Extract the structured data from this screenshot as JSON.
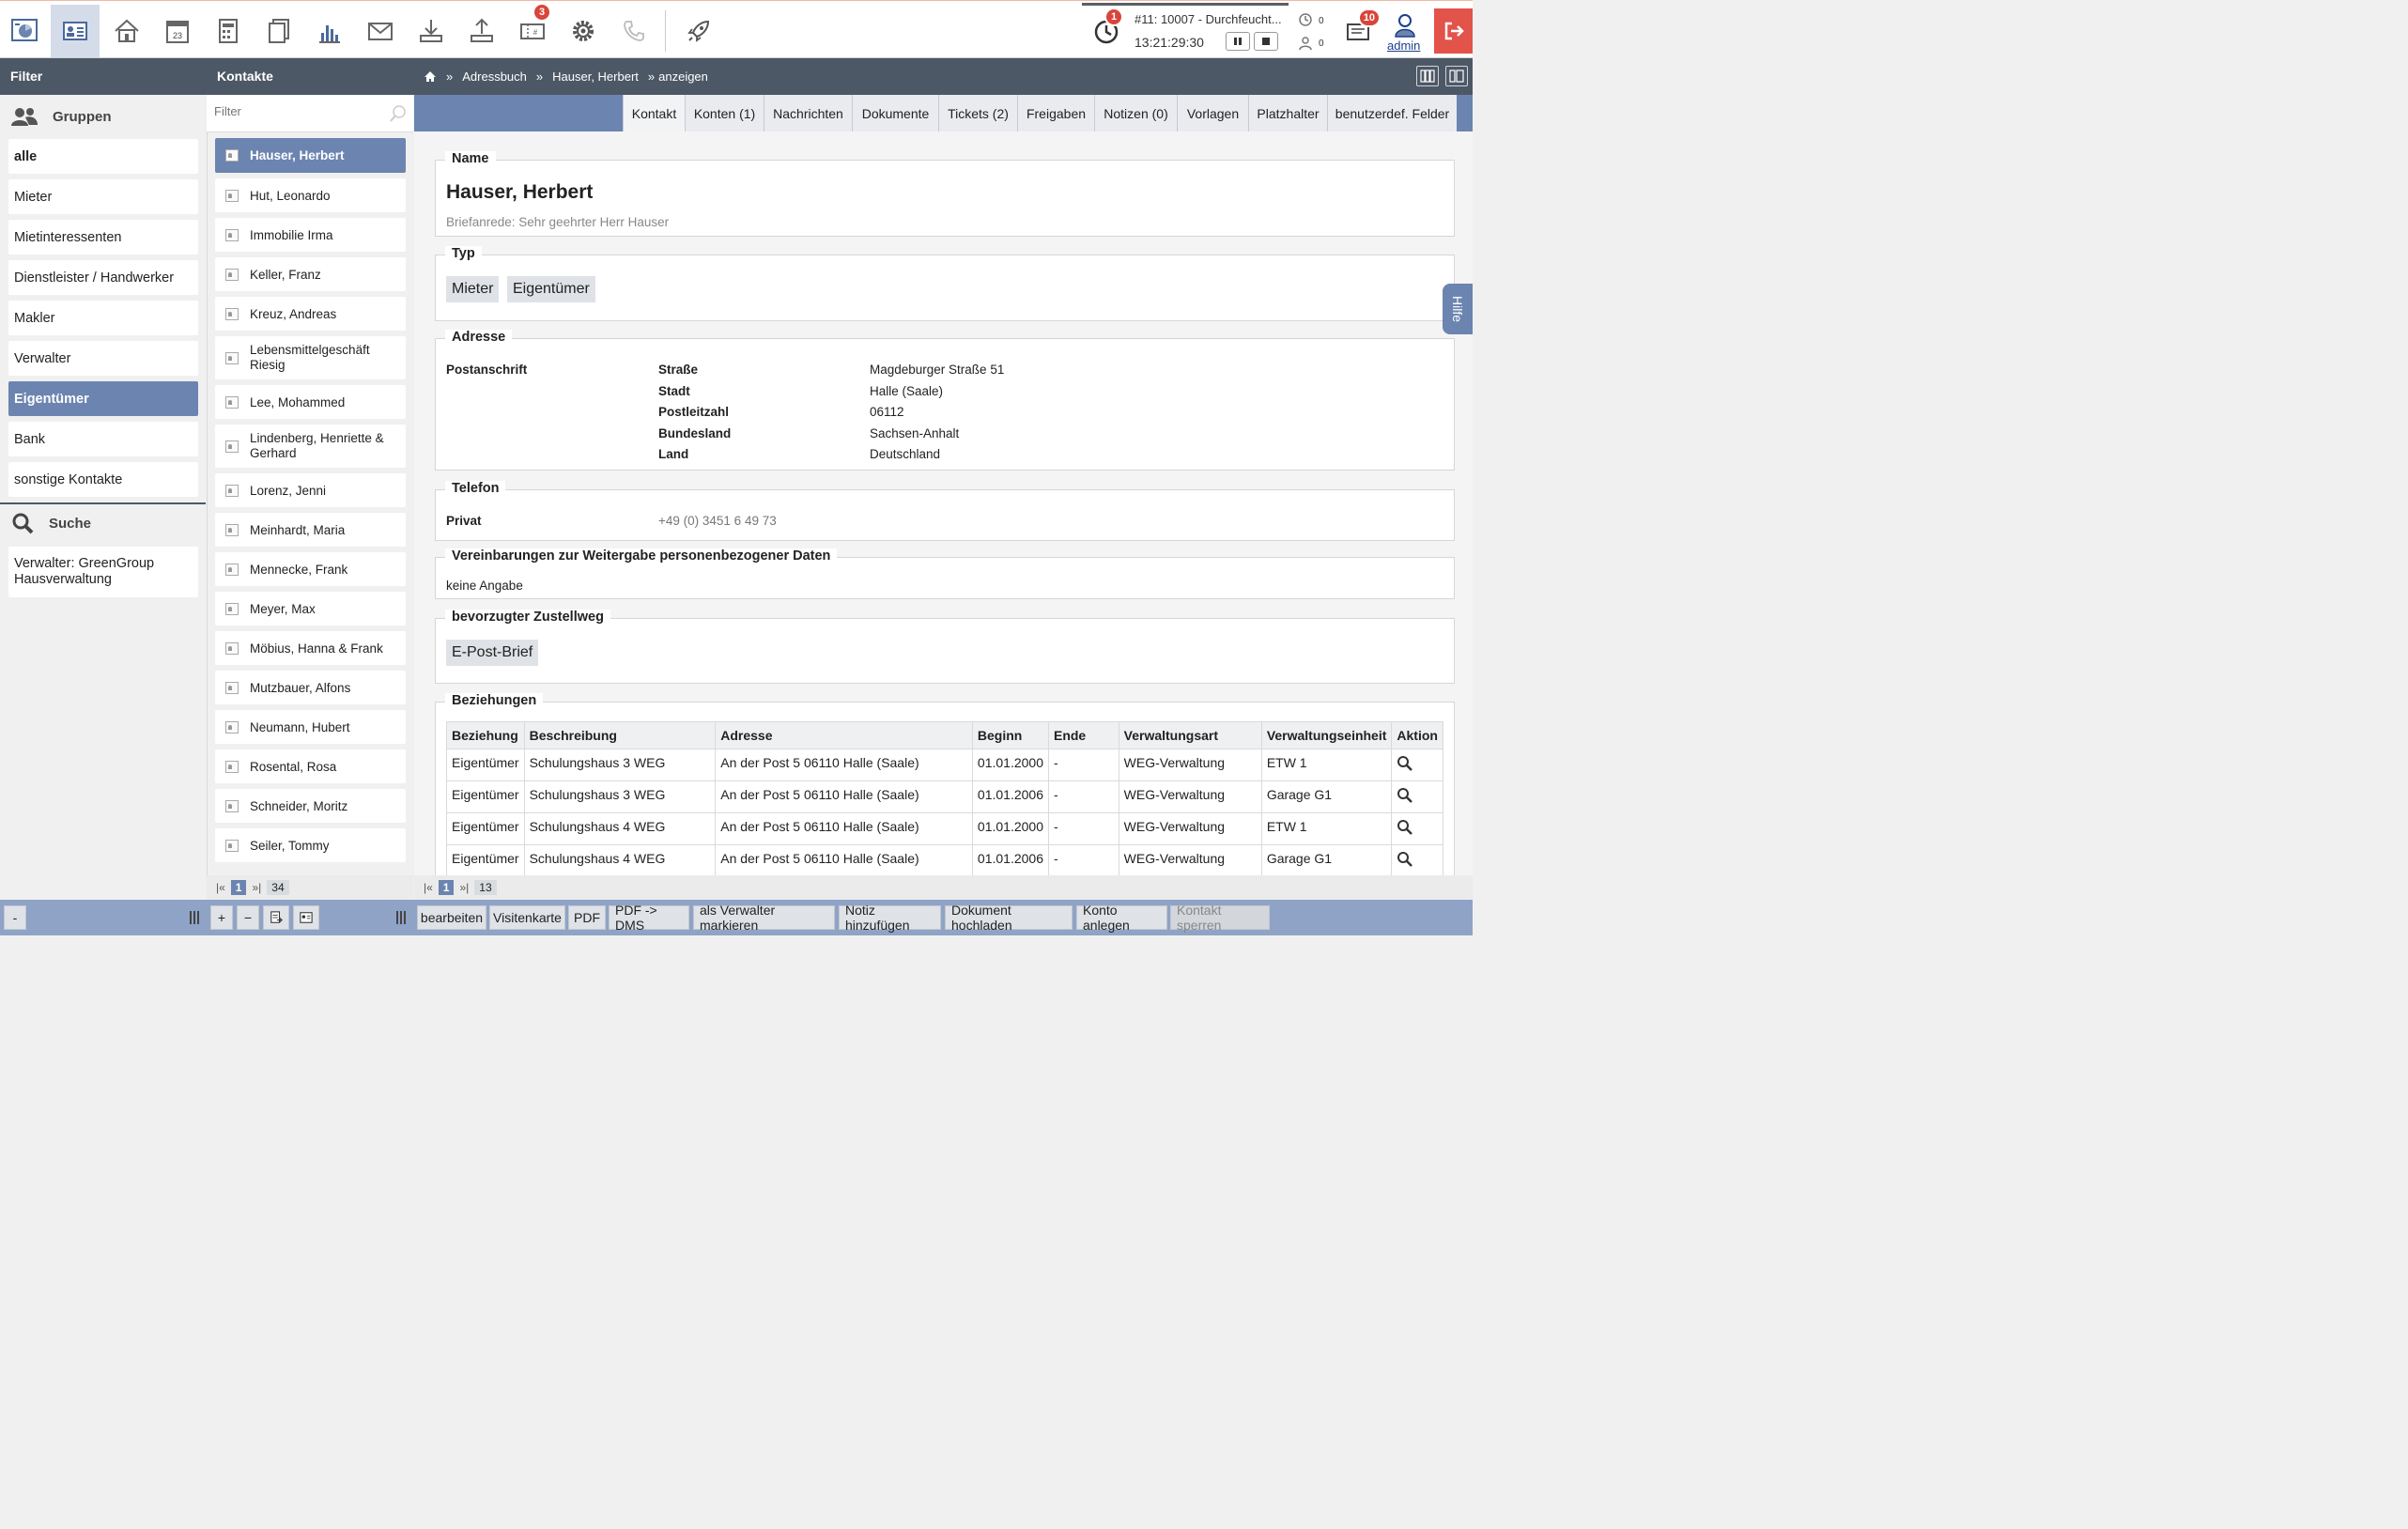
{
  "toolbar": {
    "items": [
      {
        "name": "dashboard-icon"
      },
      {
        "name": "contacts-icon"
      },
      {
        "name": "properties-icon"
      },
      {
        "name": "calendar-icon",
        "text": "23"
      },
      {
        "name": "accounting-icon"
      },
      {
        "name": "documents-icon"
      },
      {
        "name": "reports-icon"
      },
      {
        "name": "mail-icon"
      },
      {
        "name": "download-icon"
      },
      {
        "name": "upload-icon"
      },
      {
        "name": "tickets-icon",
        "badge": "3"
      },
      {
        "name": "settings-icon"
      },
      {
        "name": "phone-icon"
      },
      {
        "name": "rocket-icon"
      }
    ]
  },
  "timer": {
    "badge": "1",
    "task": "#11: 10007 - Durchfeucht...",
    "time": "13:21:29:30"
  },
  "status": {
    "count_a": "0",
    "count_b": "0"
  },
  "messages": {
    "badge": "10"
  },
  "user": {
    "name": "admin"
  },
  "header": {
    "filter_title": "Filter",
    "contacts_title": "Kontakte",
    "breadcrumb": [
      "Adressbuch",
      "Hauser, Herbert",
      "anzeigen"
    ],
    "breadcrumb_sep": "»"
  },
  "filter": {
    "groups_title": "Gruppen",
    "groups": [
      "alle",
      "Mieter",
      "Mietinteressenten",
      "Dienstleister / Handwerker",
      "Makler",
      "Verwalter",
      "Eigentümer",
      "Bank",
      "sonstige Kontakte"
    ],
    "active_group": "Eigentümer",
    "search_title": "Suche",
    "saved_search": "Verwalter: GreenGroup Hausverwaltung"
  },
  "contacts": {
    "filter_placeholder": "Filter",
    "items": [
      "Hauser, Herbert",
      "Hut, Leonardo",
      "Immobilie Irma",
      "Keller, Franz",
      "Kreuz, Andreas",
      "Lebensmittelgeschäft Riesig",
      "Lee, Mohammed",
      "Lindenberg, Henriette & Gerhard",
      "Lorenz, Jenni",
      "Meinhardt, Maria",
      "Mennecke, Frank",
      "Meyer, Max",
      "Möbius, Hanna & Frank",
      "Mutzbauer, Alfons",
      "Neumann, Hubert",
      "Rosental, Rosa",
      "Schneider, Moritz",
      "Seiler, Tommy"
    ],
    "pager": {
      "first": "|«",
      "current": "1",
      "last": "»|",
      "total": "34"
    }
  },
  "tabs": [
    "Kontakt",
    "Konten (1)",
    "Nachrichten",
    "Dokumente",
    "Tickets (2)",
    "Freigaben",
    "Notizen (0)",
    "Vorlagen",
    "Platzhalter",
    "benutzerdef. Felder"
  ],
  "detail": {
    "name_title": "Name",
    "name": "Hauser, Herbert",
    "salutation": "Briefanrede: Sehr geehrter Herr Hauser",
    "type_title": "Typ",
    "types": [
      "Mieter",
      "Eigentümer"
    ],
    "address_title": "Adresse",
    "address_kind": "Postanschrift",
    "address_labels": [
      "Straße",
      "Stadt",
      "Postleitzahl",
      "Bundesland",
      "Land"
    ],
    "address_values": [
      "Magdeburger Straße 51",
      "Halle (Saale)",
      "06112",
      "Sachsen-Anhalt",
      "Deutschland"
    ],
    "phone_title": "Telefon",
    "phone_label": "Privat",
    "phone_value": "+49 (0) 3451 6 49 73",
    "privacy_title": "Vereinbarungen zur Weitergabe personenbezogener Daten",
    "privacy_value": "keine Angabe",
    "delivery_title": "bevorzugter Zustellweg",
    "delivery_value": "E-Post-Brief",
    "relations_title": "Beziehungen",
    "relations_headers": [
      "Beziehung",
      "Beschreibung",
      "Adresse",
      "Beginn",
      "Ende",
      "Verwaltungsart",
      "Verwaltungseinheit",
      "Aktion"
    ],
    "relations_rows": [
      [
        "Eigentümer",
        "Schulungshaus 3 WEG",
        "An der Post 5 06110 Halle (Saale)",
        "01.01.2000",
        "-",
        "WEG-Verwaltung",
        "ETW 1"
      ],
      [
        "Eigentümer",
        "Schulungshaus 3 WEG",
        "An der Post 5 06110 Halle (Saale)",
        "01.01.2006",
        "-",
        "WEG-Verwaltung",
        "Garage G1"
      ],
      [
        "Eigentümer",
        "Schulungshaus 4 WEG",
        "An der Post 5 06110 Halle (Saale)",
        "01.01.2000",
        "-",
        "WEG-Verwaltung",
        "ETW 1"
      ],
      [
        "Eigentümer",
        "Schulungshaus 4 WEG",
        "An der Post 5 06110 Halle (Saale)",
        "01.01.2006",
        "-",
        "WEG-Verwaltung",
        "Garage G1"
      ]
    ]
  },
  "main_pager": {
    "first": "|«",
    "current": "1",
    "last": "»|",
    "total": "13"
  },
  "help_label": "Hilfe",
  "bottom": {
    "filter_collapse": "-",
    "list_add": "+",
    "list_remove": "−",
    "actions": [
      "bearbeiten",
      "Visitenkarte",
      "PDF",
      "PDF -> DMS",
      "als Verwalter markieren",
      "Notiz hinzufügen",
      "Dokument hochladen",
      "Konto anlegen",
      "Kontakt sperren"
    ]
  },
  "colors": {
    "accent": "#6c84b0",
    "header": "#4d5866",
    "badge": "#d9453b",
    "logout": "#e2534a",
    "bottom": "#8fa3c6"
  }
}
